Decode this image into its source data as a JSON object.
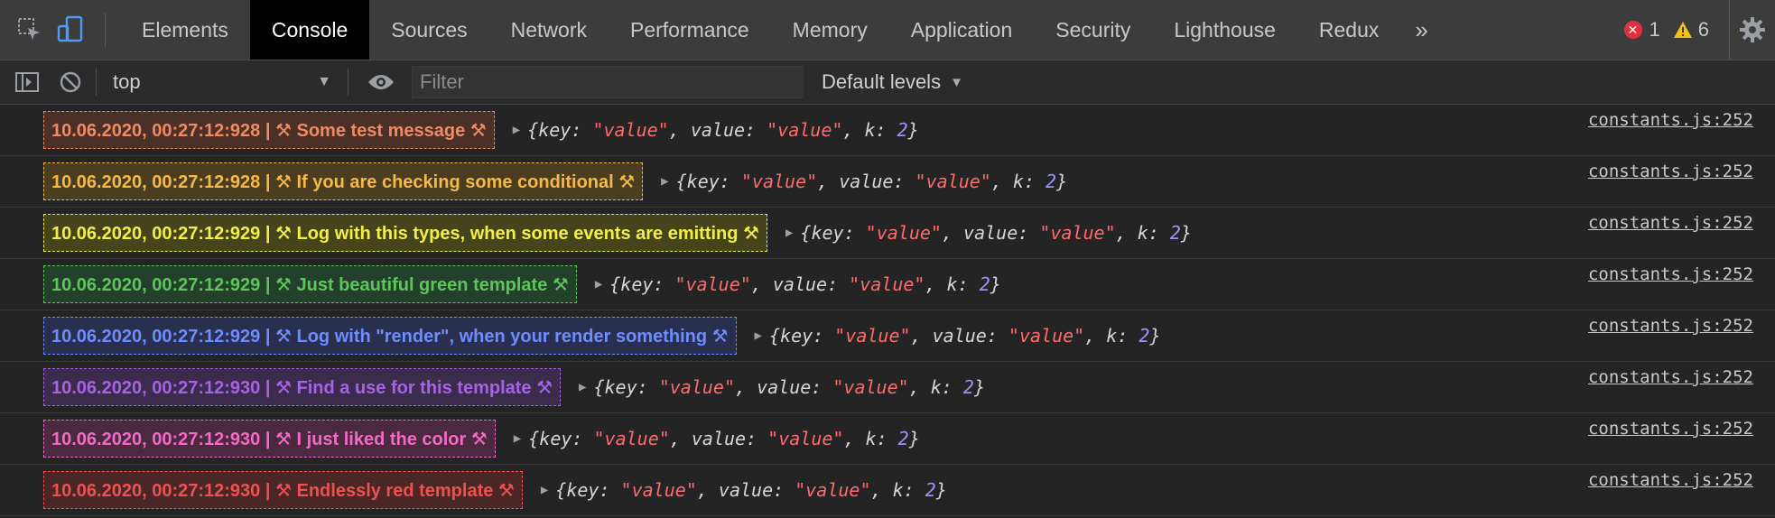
{
  "tabs": [
    "Elements",
    "Console",
    "Sources",
    "Network",
    "Performance",
    "Memory",
    "Application",
    "Security",
    "Lighthouse",
    "Redux"
  ],
  "active_tab": 1,
  "more_label": "»",
  "status": {
    "errors": "1",
    "warnings": "6"
  },
  "toolbar": {
    "context": "top",
    "filter_placeholder": "Filter",
    "levels_label": "Default levels"
  },
  "object_parts": {
    "open": "{",
    "key_label": "key: ",
    "value_label": ", value: ",
    "k_label": ", k: ",
    "str_value": "\"value\"",
    "num_value": "2",
    "close": "}"
  },
  "logs": [
    {
      "text": "10.06.2020, 00:27:12:928 | ⚒ Some test message ⚒",
      "color": "#f08a65",
      "bg": "#4a3026",
      "src": "constants.js:252"
    },
    {
      "text": "10.06.2020, 00:27:12:928 | ⚒ If you are checking some conditional ⚒",
      "color": "#f5b94a",
      "bg": "#4a3d20",
      "src": "constants.js:252"
    },
    {
      "text": "10.06.2020, 00:27:12:929 | ⚒ Log with this types, when some events are emitting ⚒",
      "color": "#f2ee4a",
      "bg": "#46441c",
      "src": "constants.js:252"
    },
    {
      "text": "10.06.2020, 00:27:12:929 | ⚒ Just beautiful green template ⚒",
      "color": "#5cc55c",
      "bg": "#23402a",
      "src": "constants.js:252"
    },
    {
      "text": "10.06.2020, 00:27:12:929 | ⚒ Log with \"render\", when your render something ⚒",
      "color": "#6f8cff",
      "bg": "#29304f",
      "src": "constants.js:252"
    },
    {
      "text": "10.06.2020, 00:27:12:930 | ⚒ Find a use for this template ⚒",
      "color": "#a763e6",
      "bg": "#3b2b4d",
      "src": "constants.js:252"
    },
    {
      "text": "10.06.2020, 00:27:12:930 | ⚒ I just liked the color ⚒",
      "color": "#f26ac4",
      "bg": "#4b2a41",
      "src": "constants.js:252"
    },
    {
      "text": "10.06.2020, 00:27:12:930 | ⚒ Endlessly red template ⚒",
      "color": "#ef5050",
      "bg": "#4a2627",
      "src": "constants.js:252"
    }
  ]
}
